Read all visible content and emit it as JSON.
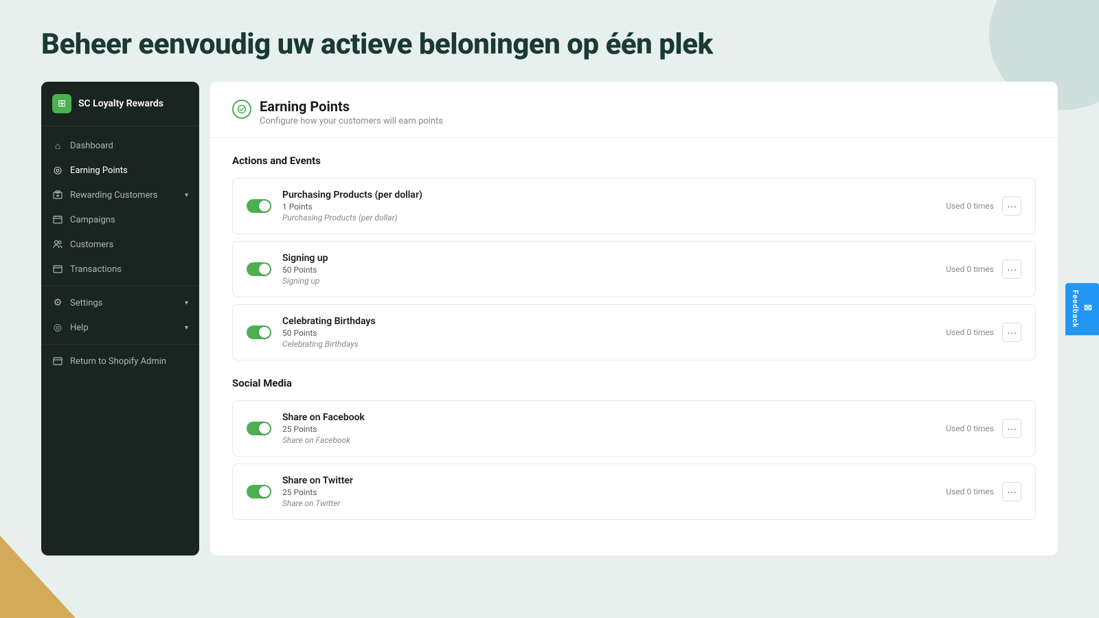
{
  "page": {
    "headline": "Beheer eenvoudig uw actieve beloningen op één plek"
  },
  "sidebar": {
    "logo": {
      "text": "SC Loyalty Rewards",
      "icon": "⊞"
    },
    "items": [
      {
        "id": "dashboard",
        "label": "Dashboard",
        "icon": "⌂",
        "hasChevron": false,
        "active": false
      },
      {
        "id": "earning-points",
        "label": "Earning Points",
        "icon": "◎",
        "hasChevron": false,
        "active": true
      },
      {
        "id": "rewarding-customers",
        "label": "Rewarding Customers",
        "icon": "⊞",
        "hasChevron": true,
        "active": false
      },
      {
        "id": "campaigns",
        "label": "Campaigns",
        "icon": "⊞",
        "hasChevron": false,
        "active": false
      },
      {
        "id": "customers",
        "label": "Customers",
        "icon": "⚇",
        "hasChevron": false,
        "active": false
      },
      {
        "id": "transactions",
        "label": "Transactions",
        "icon": "⊞",
        "hasChevron": false,
        "active": false
      },
      {
        "id": "settings",
        "label": "Settings",
        "icon": "⚙",
        "hasChevron": true,
        "active": false
      },
      {
        "id": "help",
        "label": "Help",
        "icon": "◎",
        "hasChevron": true,
        "active": false
      },
      {
        "id": "return-shopify",
        "label": "Return to Shopify Admin",
        "icon": "⊞",
        "hasChevron": false,
        "active": false
      }
    ]
  },
  "content": {
    "title": "Earning Points",
    "subtitle": "Configure how your customers will earn points",
    "sections": [
      {
        "id": "actions-events",
        "title": "Actions and Events",
        "events": [
          {
            "id": "purchasing-products",
            "name": "Purchasing Products (per dollar)",
            "points": "1 Points",
            "description": "Purchasing Products (per dollar)",
            "used": "Used 0 times",
            "enabled": true
          },
          {
            "id": "signing-up",
            "name": "Signing up",
            "points": "50 Points",
            "description": "Signing up",
            "used": "Used 0 times",
            "enabled": true
          },
          {
            "id": "celebrating-birthdays",
            "name": "Celebrating Birthdays",
            "points": "50 Points",
            "description": "Celebrating Birthdays",
            "used": "Used 0 times",
            "enabled": true
          }
        ]
      },
      {
        "id": "social-media",
        "title": "Social Media",
        "events": [
          {
            "id": "share-facebook",
            "name": "Share on Facebook",
            "points": "25 Points",
            "description": "Share on Facebook",
            "used": "Used 0 times",
            "enabled": true
          },
          {
            "id": "share-twitter",
            "name": "Share on Twitter",
            "points": "25 Points",
            "description": "Share on Twitter",
            "used": "Used 0 times",
            "enabled": true
          }
        ]
      }
    ]
  },
  "feedback": {
    "label": "Feedback"
  }
}
